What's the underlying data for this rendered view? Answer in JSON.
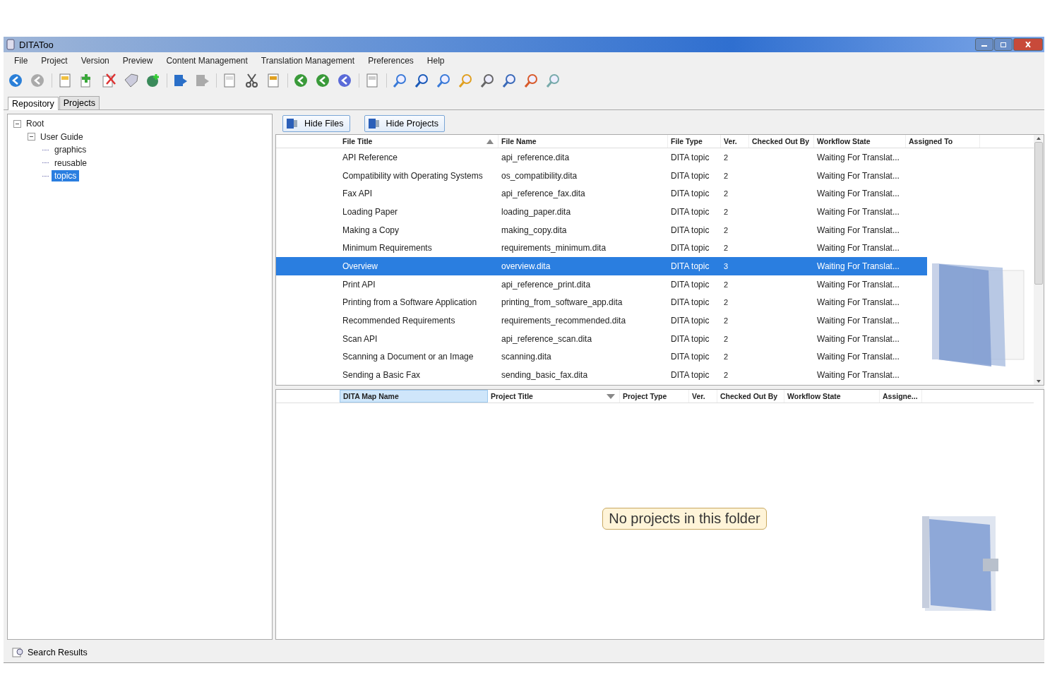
{
  "window": {
    "title": "DITAToo"
  },
  "menu": [
    "File",
    "Project",
    "Version",
    "Preview",
    "Content Management",
    "Translation Management",
    "Preferences",
    "Help"
  ],
  "tabs": [
    {
      "label": "Repository",
      "selected": true
    },
    {
      "label": "Projects",
      "selected": false
    }
  ],
  "tree": [
    {
      "label": "Root",
      "expanded": true,
      "selected": false,
      "children": [
        {
          "label": "User Guide",
          "expanded": true,
          "selected": false,
          "children": [
            {
              "label": "graphics",
              "selected": false
            },
            {
              "label": "reusable",
              "selected": false
            },
            {
              "label": "topics",
              "selected": true
            }
          ]
        }
      ]
    }
  ],
  "view_buttons": [
    "Hide Files",
    "Hide Projects"
  ],
  "files_table": {
    "columns": [
      {
        "label": "File Title",
        "sort_ascending": true
      },
      {
        "label": "File Name"
      },
      {
        "label": "File Type"
      },
      {
        "label": "Ver."
      },
      {
        "label": "Checked Out By"
      },
      {
        "label": "Workflow State"
      },
      {
        "label": "Assigned To"
      }
    ],
    "rows": [
      {
        "cells": [
          "API Reference",
          "api_reference.dita",
          "DITA topic",
          "2",
          "",
          "Waiting For Translat...",
          ""
        ],
        "selected": false
      },
      {
        "cells": [
          "Compatibility with Operating Systems",
          "os_compatibility.dita",
          "DITA topic",
          "2",
          "",
          "Waiting For Translat...",
          ""
        ],
        "selected": false
      },
      {
        "cells": [
          "Fax API",
          "api_reference_fax.dita",
          "DITA topic",
          "2",
          "",
          "Waiting For Translat...",
          ""
        ],
        "selected": false
      },
      {
        "cells": [
          "Loading Paper",
          "loading_paper.dita",
          "DITA topic",
          "2",
          "",
          "Waiting For Translat...",
          ""
        ],
        "selected": false
      },
      {
        "cells": [
          "Making a Copy",
          "making_copy.dita",
          "DITA topic",
          "2",
          "",
          "Waiting For Translat...",
          ""
        ],
        "selected": false
      },
      {
        "cells": [
          "Minimum Requirements",
          "requirements_minimum.dita",
          "DITA topic",
          "2",
          "",
          "Waiting For Translat...",
          ""
        ],
        "selected": false
      },
      {
        "cells": [
          "Overview",
          "overview.dita",
          "DITA topic",
          "3",
          "",
          "Waiting For Translat...",
          ""
        ],
        "selected": true
      },
      {
        "cells": [
          "Print API",
          "api_reference_print.dita",
          "DITA topic",
          "2",
          "",
          "Waiting For Translat...",
          ""
        ],
        "selected": false
      },
      {
        "cells": [
          "Printing from a Software Application",
          "printing_from_software_app.dita",
          "DITA topic",
          "2",
          "",
          "Waiting For Translat...",
          ""
        ],
        "selected": false
      },
      {
        "cells": [
          "Recommended Requirements",
          "requirements_recommended.dita",
          "DITA topic",
          "2",
          "",
          "Waiting For Translat...",
          ""
        ],
        "selected": false
      },
      {
        "cells": [
          "Scan API",
          "api_reference_scan.dita",
          "DITA topic",
          "2",
          "",
          "Waiting For Translat...",
          ""
        ],
        "selected": false
      },
      {
        "cells": [
          "Scanning a Document or an Image",
          "scanning.dita",
          "DITA topic",
          "2",
          "",
          "Waiting For Translat...",
          ""
        ],
        "selected": false
      },
      {
        "cells": [
          "Sending a Basic Fax",
          "sending_basic_fax.dita",
          "DITA topic",
          "2",
          "",
          "Waiting For Translat...",
          ""
        ],
        "selected": false
      }
    ]
  },
  "projects_table": {
    "columns": [
      {
        "label": "DITA Map Name",
        "highlighted": true
      },
      {
        "label": "Project Title",
        "sort_ascending": false
      },
      {
        "label": "Project Type"
      },
      {
        "label": "Ver."
      },
      {
        "label": "Checked Out By"
      },
      {
        "label": "Workflow State"
      },
      {
        "label": "Assigne..."
      }
    ],
    "empty_message": "No projects in this folder"
  },
  "status_bar": {
    "label": "Search Results"
  }
}
